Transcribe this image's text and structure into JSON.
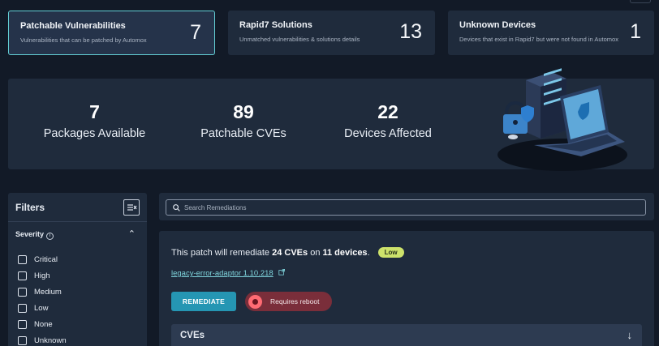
{
  "cards": [
    {
      "title": "Patchable Vulnerabilities",
      "subtitle": "Vulnerabilities that can be patched by Automox",
      "count": "7"
    },
    {
      "title": "Rapid7 Solutions",
      "subtitle": "Unmatched vulnerabilities & solutions details",
      "count": "13"
    },
    {
      "title": "Unknown Devices",
      "subtitle": "Devices that exist in Rapid7 but were not found in Automox",
      "count": "1"
    }
  ],
  "stats": [
    {
      "value": "7",
      "label": "Packages Available"
    },
    {
      "value": "89",
      "label": "Patchable CVEs"
    },
    {
      "value": "22",
      "label": "Devices Affected"
    }
  ],
  "filters": {
    "title": "Filters",
    "severity_label": "Severity",
    "options": [
      "Critical",
      "High",
      "Medium",
      "Low",
      "None",
      "Unknown"
    ]
  },
  "search": {
    "placeholder": "Search Remediations"
  },
  "remediation": {
    "prefix": "This patch will remediate ",
    "cve_count": "24 CVEs",
    "middle": " on ",
    "device_count": "11 devices",
    "suffix": ".",
    "severity_badge": "Low",
    "package_link": "legacy-error-adaptor 1.10.218",
    "remediate_button": "REMEDIATE",
    "reboot_label": "Requires reboot",
    "cves_section": "CVEs"
  },
  "colors": {
    "background": "#121a27",
    "card": "#1f2b3c",
    "accent": "#63d0d6",
    "button": "#2596b3",
    "badge_low": "#cde26b",
    "reboot": "#7a2e3a"
  }
}
